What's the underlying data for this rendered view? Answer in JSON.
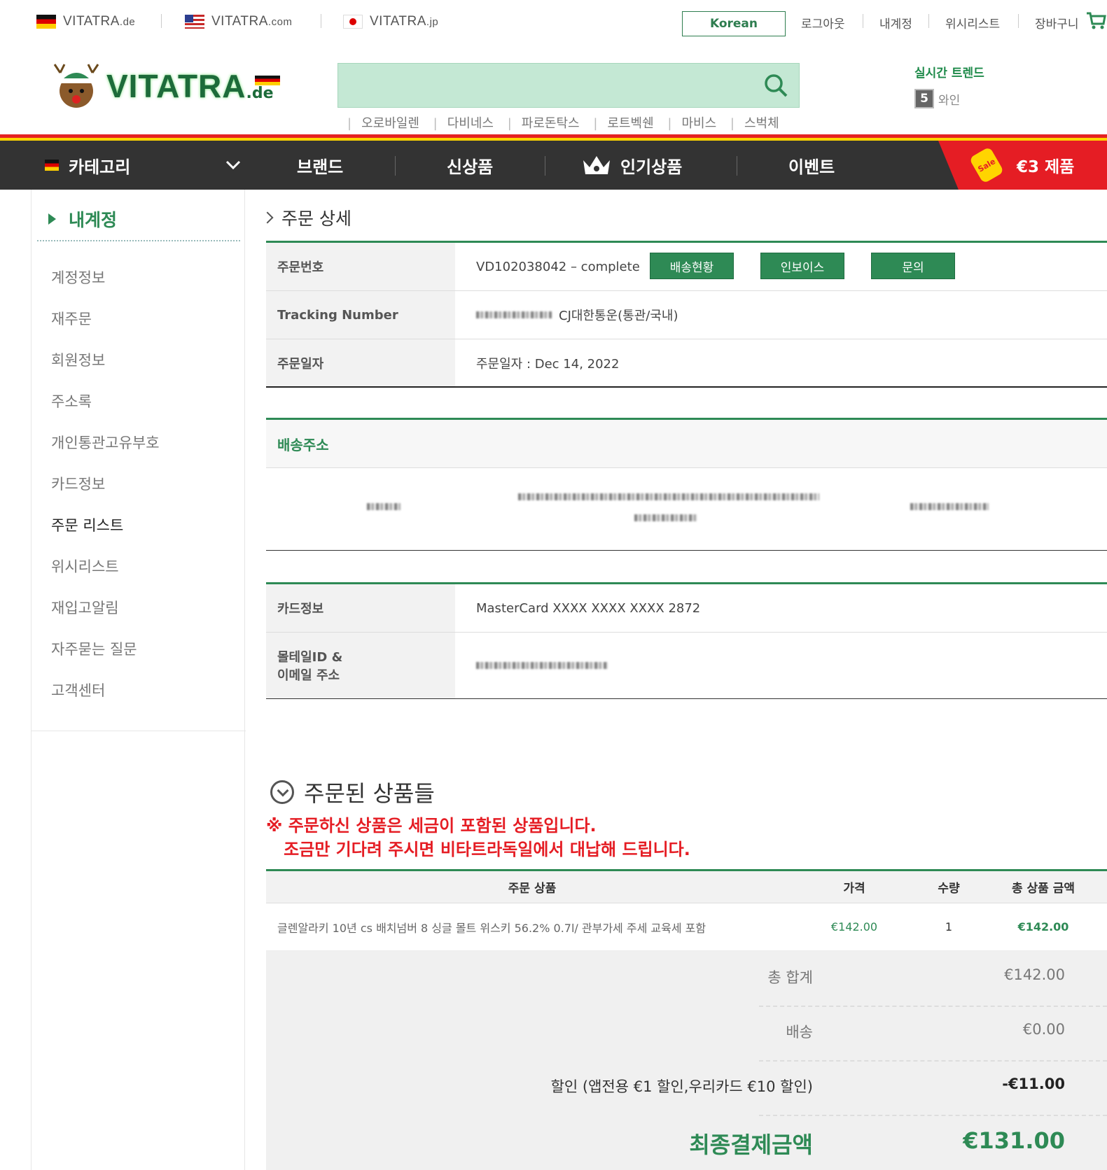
{
  "top_sites": [
    {
      "name": "VITATRA",
      "tld": ".de",
      "flag": "flag-de"
    },
    {
      "name": "VITATRA",
      "tld": ".com",
      "flag": "flag-us"
    },
    {
      "name": "VITATRA",
      "tld": ".jp",
      "flag": "flag-jp"
    }
  ],
  "top_links": {
    "language": "Korean",
    "logout": "로그아웃",
    "my_account": "내계정",
    "wishlist": "위시리스트",
    "cart": "장바구니"
  },
  "logo": {
    "text": "VITATRA",
    "suffix": ".de"
  },
  "search": {
    "placeholder": "",
    "value": ""
  },
  "keywords": [
    "오로바일렌",
    "다비네스",
    "파로돈탁스",
    "로트벡쉔",
    "마비스",
    "스벅체"
  ],
  "trend": {
    "title": "실시간 트렌드",
    "rank": "5",
    "term": "와인"
  },
  "nav": {
    "category": "카테고리",
    "brand": "브랜드",
    "new": "신상품",
    "popular": "인기상품",
    "event": "이벤트",
    "sale_tag": "Sale",
    "sale": "€3 제품"
  },
  "sidebar": {
    "title": "내계정",
    "items": [
      "계정정보",
      "재주문",
      "회원정보",
      "주소록",
      "개인통관고유부호",
      "카드정보",
      "주문 리스트",
      "위시리스트",
      "재입고알림",
      "자주묻는 질문",
      "고객센터"
    ],
    "active_index": 6
  },
  "page": {
    "title": "주문 상세"
  },
  "order": {
    "number_label": "주문번호",
    "number_value": "VD102038042 – complete",
    "btn_shipping": "배송현황",
    "btn_invoice": "인보이스",
    "btn_inquiry": "문의",
    "tracking_label": "Tracking Number",
    "tracking_carrier": "CJ대한통운(통관/국내)",
    "date_label": "주문일자",
    "date_value": "주문일자 : Dec 14, 2022"
  },
  "shipping": {
    "title": "배송주소"
  },
  "payment": {
    "card_label": "카드정보",
    "card_value": "MasterCard XXXX XXXX XXXX 2872",
    "id_label_1": "몰테일ID &",
    "id_label_2": "이메일 주소"
  },
  "ordered": {
    "title": "주문된 상품들",
    "notice": "※ 주문하신 상품은 세금이 포함된 상품입니다.\n   조금만 기다려 주시면 비타트라독일에서 대납해 드립니다.",
    "headers": [
      "주문 상품",
      "가격",
      "수량",
      "총 상품 금액"
    ],
    "rows": [
      {
        "name": "글렌알라키 10년 cs 배치넘버 8 싱글 몰트 위스키 56.2% 0.7l/ 관부가세 주세 교육세 포함",
        "price": "€142.00",
        "qty": "1",
        "total": "€142.00"
      }
    ]
  },
  "summary": {
    "subtotal_label": "총 합계",
    "subtotal": "€142.00",
    "shipping_label": "배송",
    "shipping": "€0.00",
    "discount_label": "할인 (앱전용 €1 할인,우리카드 €10 할인)",
    "discount": "-€11.00",
    "final_label": "최종결제금액",
    "final": "€131.00"
  },
  "colors": {
    "accent": "#2e8a55",
    "nav_bg": "#333333",
    "sale_red": "#e51d24",
    "search_bg": "#c4e8d4"
  }
}
